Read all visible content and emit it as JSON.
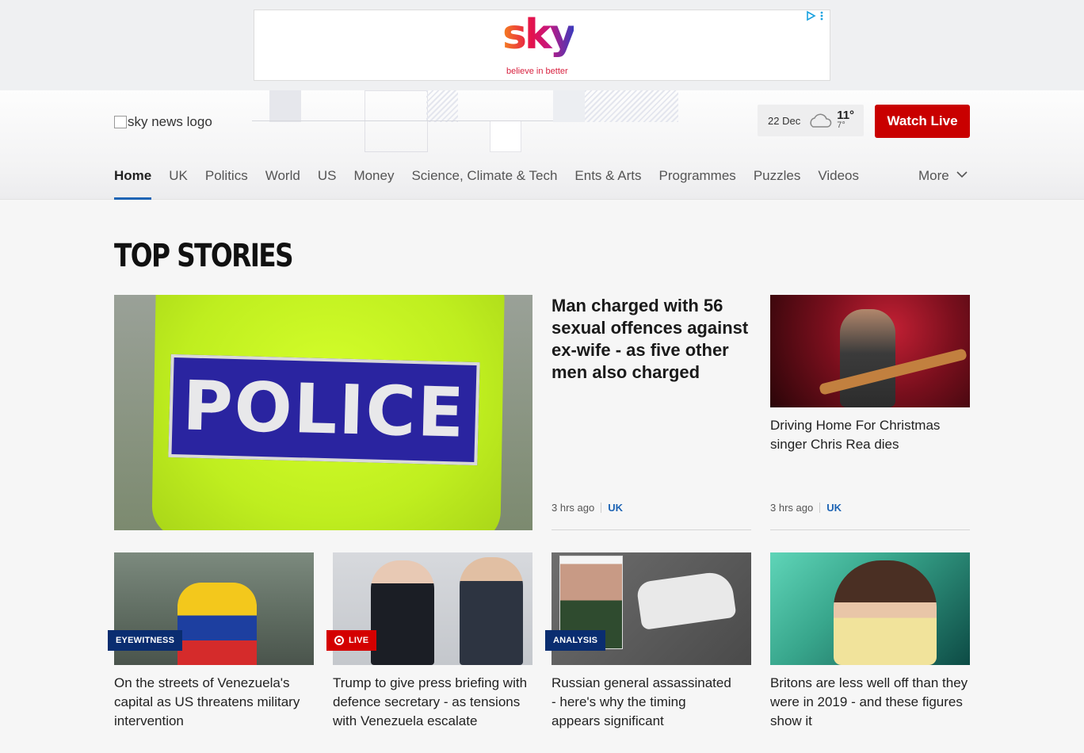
{
  "ad": {
    "brand": "sky",
    "tagline": "believe in better",
    "adchoices_icon": "ad-choices-icon",
    "menu_icon": "vertical-dots-icon"
  },
  "header": {
    "logo_alt": "sky news logo",
    "weather": {
      "date": "22 Dec",
      "icon": "cloud-icon",
      "high": "11°",
      "low": "7°"
    },
    "watch_live": "Watch Live",
    "nav": {
      "items": [
        "Home",
        "UK",
        "Politics",
        "World",
        "US",
        "Money",
        "Science, Climate & Tech",
        "Ents & Arts",
        "Programmes",
        "Puzzles",
        "Videos"
      ],
      "active": "Home",
      "more": "More"
    }
  },
  "main": {
    "section_title": "TOP STORIES",
    "lead": {
      "image_text": "POLICE",
      "headline": "Man charged with 56 sexual offences against ex-wife - as five other men also charged",
      "time": "3 hrs ago",
      "tag": "UK"
    },
    "side": {
      "headline": "Driving Home For Christmas singer Chris Rea dies",
      "time": "3 hrs ago",
      "tag": "UK"
    },
    "cards": [
      {
        "badge": "EYEWITNESS",
        "headline": "On the streets of Venezuela's capital as US threatens military intervention"
      },
      {
        "badge": "LIVE",
        "headline": "Trump to give press briefing with defence secretary - as tensions with Venezuela escalate"
      },
      {
        "badge": "ANALYSIS",
        "headline": "Russian general assassinated - here's why the timing appears significant"
      },
      {
        "badge": "",
        "headline": "Britons are less well off than they were in 2019 - and these figures show it"
      }
    ]
  },
  "colors": {
    "accent_blue": "#1e64b4",
    "live_red": "#c90000",
    "badge_navy": "#0a2d70"
  }
}
